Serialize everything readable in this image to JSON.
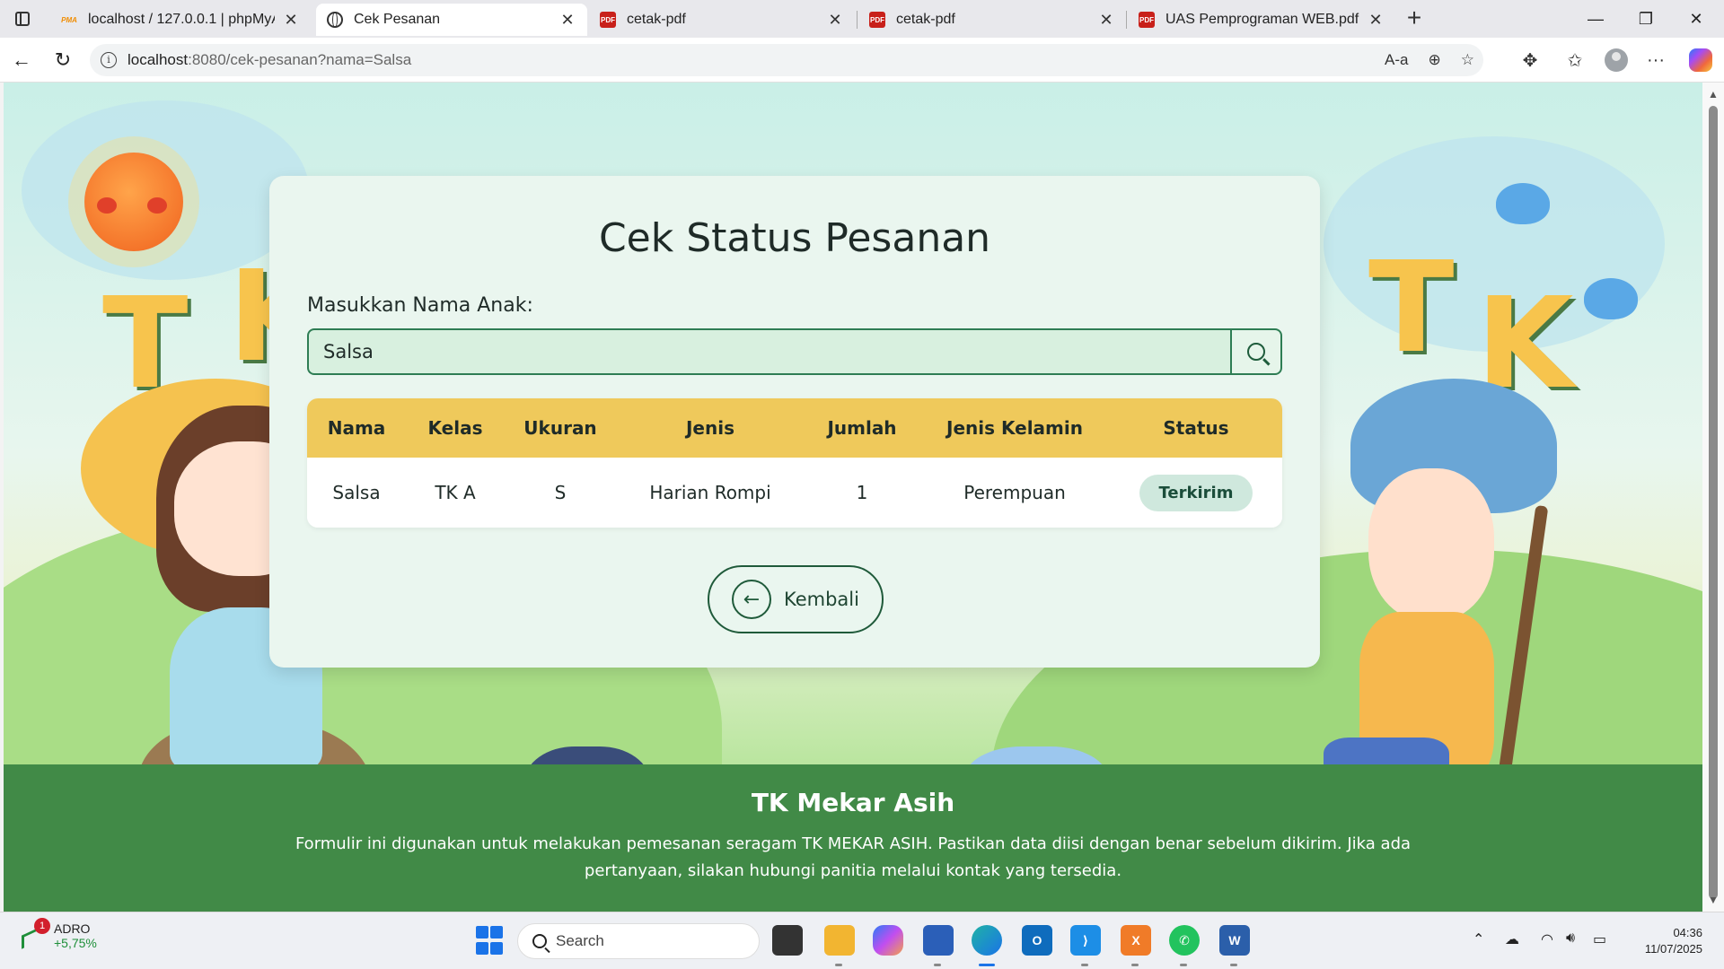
{
  "browser": {
    "tabs": [
      {
        "title": "localhost / 127.0.0.1 | phpMyAdm",
        "favicon": "phpmyadmin-icon",
        "active": false
      },
      {
        "title": "Cek Pesanan",
        "favicon": "globe-icon",
        "active": true
      },
      {
        "title": "cetak-pdf",
        "favicon": "pdf-icon",
        "active": false
      },
      {
        "title": "cetak-pdf",
        "favicon": "pdf-icon",
        "active": false
      },
      {
        "title": "UAS Pemprograman WEB.pdf",
        "favicon": "pdf-icon",
        "active": false
      }
    ],
    "url_host": "localhost",
    "url_rest": ":8080/cek-pesanan?nama=Salsa"
  },
  "page": {
    "title": "Cek Status Pesanan",
    "field_label": "Masukkan Nama Anak:",
    "search_value": "Salsa",
    "table": {
      "headers": [
        "Nama",
        "Kelas",
        "Ukuran",
        "Jenis",
        "Jumlah",
        "Jenis Kelamin",
        "Status"
      ],
      "rows": [
        {
          "nama": "Salsa",
          "kelas": "TK A",
          "ukuran": "S",
          "jenis": "Harian Rompi",
          "jumlah": "1",
          "jenis_kelamin": "Perempuan",
          "status": "Terkirim"
        }
      ]
    },
    "back_label": "Kembali",
    "footer": {
      "title": "TK Mekar Asih",
      "text": "Formulir ini digunakan untuk melakukan pemesanan seragam TK MEKAR ASIH. Pastikan data diisi dengan benar sebelum dikirim. Jika ada pertanyaan, silakan hubungi panitia melalui kontak yang tersedia."
    },
    "colors": {
      "header_yellow": "#efc95b",
      "footer_green": "#418a47",
      "accent_green": "#2e7d54",
      "badge_bg": "#cfe8dd"
    }
  },
  "taskbar": {
    "stock_name": "ADRO",
    "stock_change": "+5,75%",
    "notification_count": "1",
    "search_placeholder": "Search",
    "time": "04:36",
    "date": "11/07/2025"
  }
}
